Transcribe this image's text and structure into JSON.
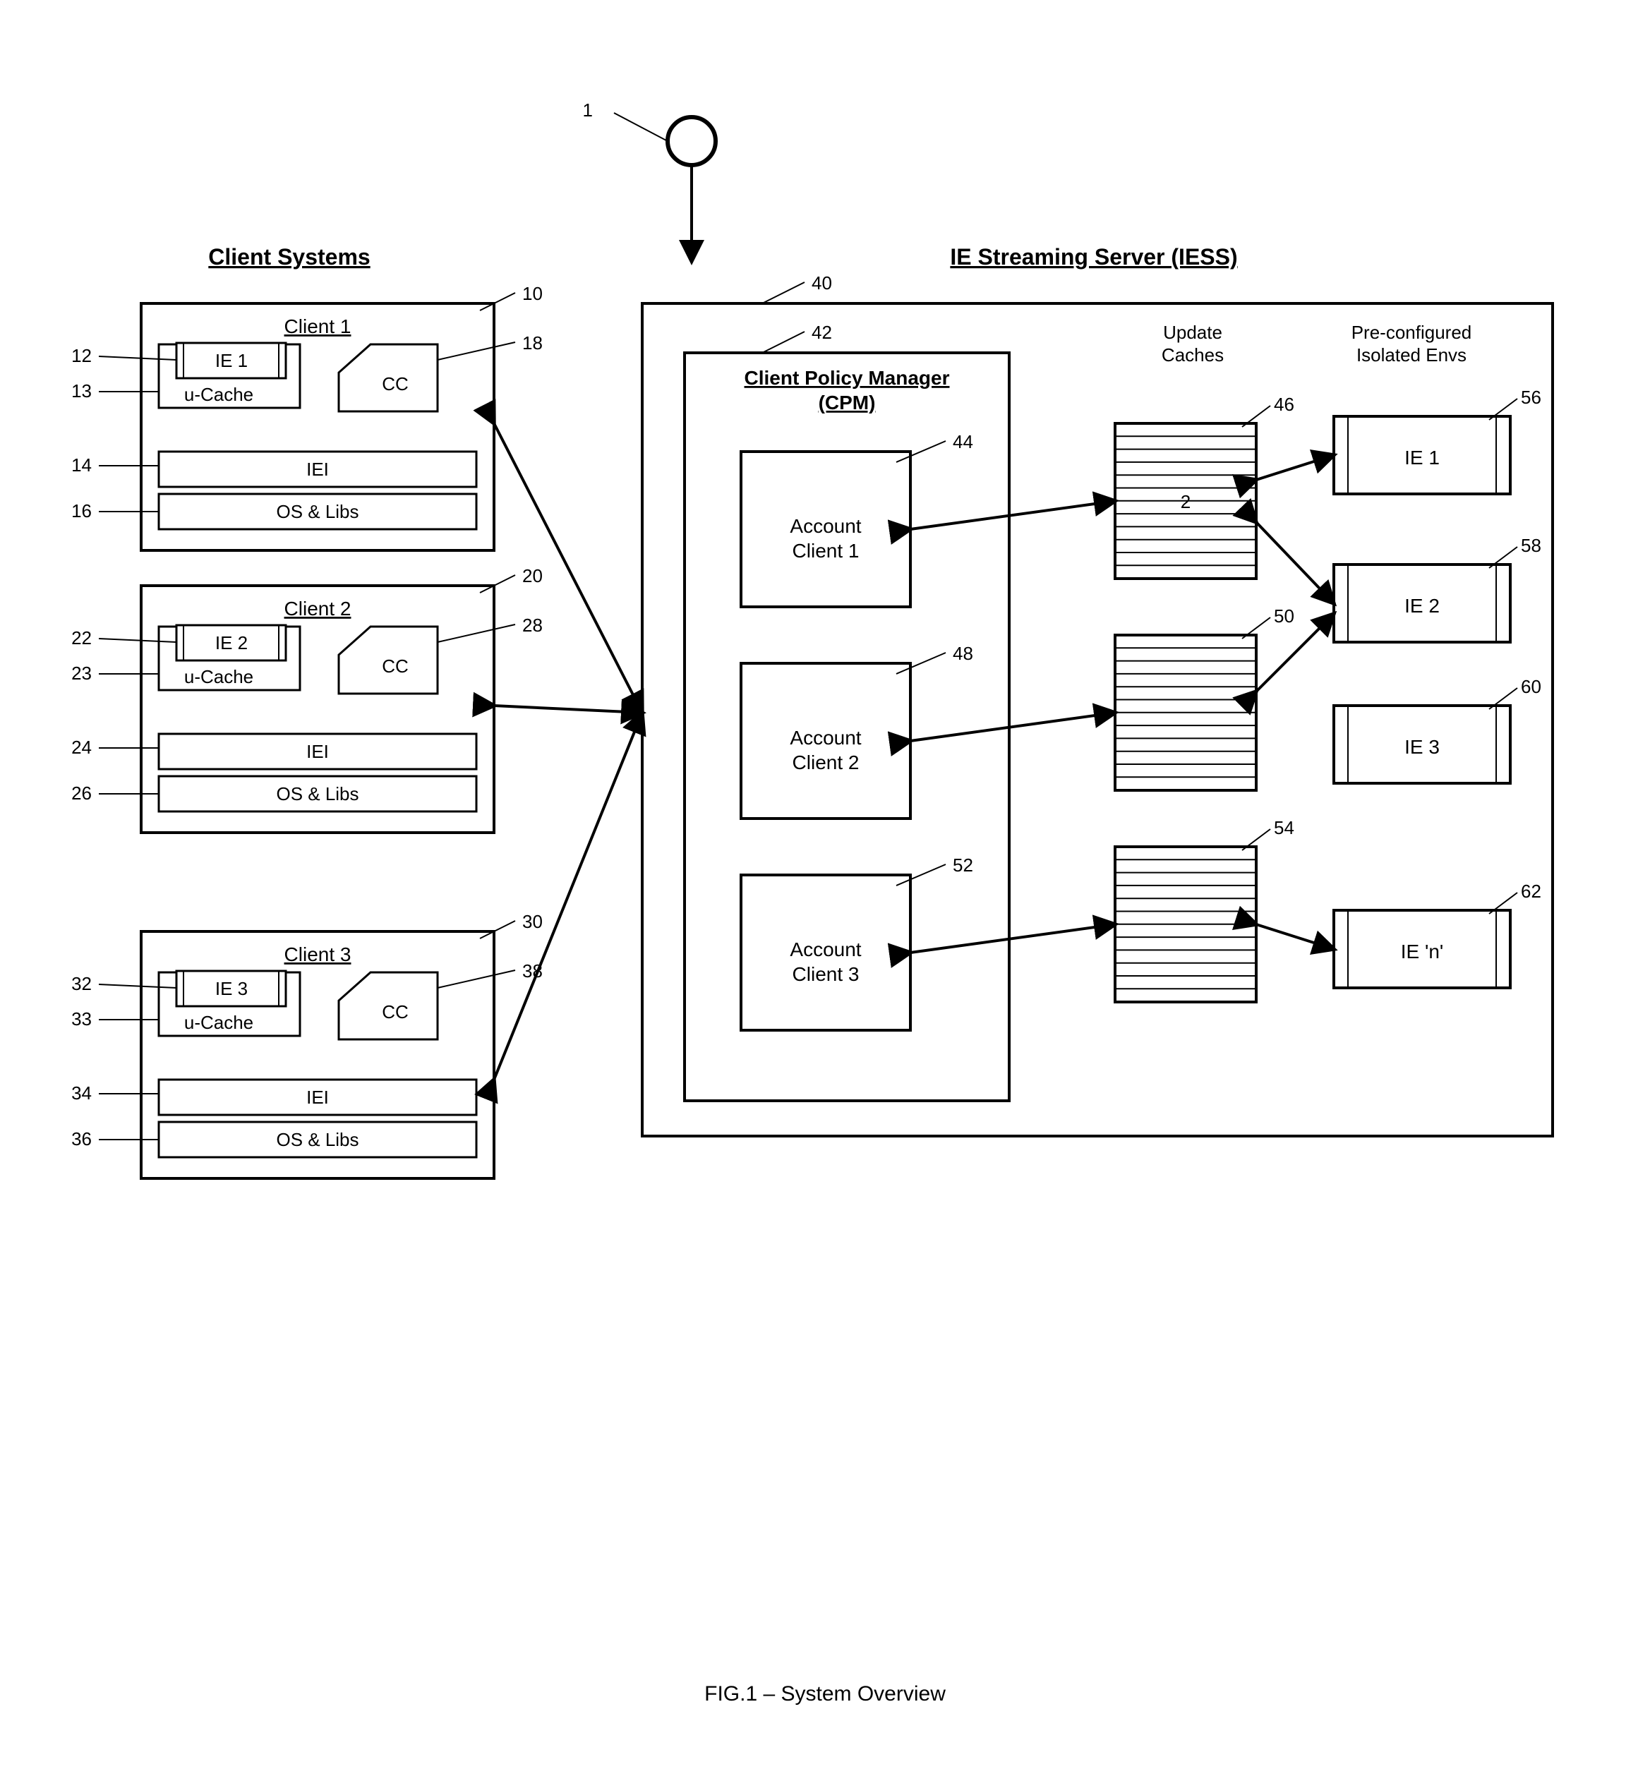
{
  "headers": {
    "clients": "Client Systems",
    "server": "IE Streaming Server (IESS)"
  },
  "topRef": "1",
  "clients": [
    {
      "title": "Client 1",
      "ie": "IE 1",
      "ucache": "u-Cache",
      "cc": "CC",
      "iei": "IEI",
      "os": "OS & Libs",
      "boxRef": "10",
      "ieRef": "12",
      "ucacheRef": "13",
      "ieiRef": "14",
      "osRef": "16",
      "ccRef": "18"
    },
    {
      "title": "Client 2",
      "ie": "IE 2",
      "ucache": "u-Cache",
      "cc": "CC",
      "iei": "IEI",
      "os": "OS & Libs",
      "boxRef": "20",
      "ieRef": "22",
      "ucacheRef": "23",
      "ieiRef": "24",
      "osRef": "26",
      "ccRef": "28"
    },
    {
      "title": "Client 3",
      "ie": "IE 3",
      "ucache": "u-Cache",
      "cc": "CC",
      "iei": "IEI",
      "os": "OS & Libs",
      "boxRef": "30",
      "ieRef": "32",
      "ucacheRef": "33",
      "ieiRef": "34",
      "osRef": "36",
      "ccRef": "38"
    }
  ],
  "server": {
    "boxRef": "40",
    "cpm": {
      "title1": "Client Policy Manager",
      "title2": "(CPM)",
      "boxRef": "42",
      "accounts": [
        {
          "l1": "Account",
          "l2": "Client 1",
          "ref": "44"
        },
        {
          "l1": "Account",
          "l2": "Client  2",
          "ref": "48"
        },
        {
          "l1": "Account",
          "l2": "Client 3",
          "ref": "52"
        }
      ]
    },
    "updateCaches": {
      "header1": "Update",
      "header2": "Caches",
      "innerLabel": "2",
      "refs": [
        "46",
        "50",
        "54"
      ]
    },
    "preEnvs": {
      "header1": "Pre-configured",
      "header2": "Isolated Envs",
      "items": [
        {
          "label": "IE 1",
          "ref": "56"
        },
        {
          "label": "IE 2",
          "ref": "58"
        },
        {
          "label": "IE 3",
          "ref": "60"
        },
        {
          "label": "IE 'n'",
          "ref": "62"
        }
      ]
    }
  },
  "figure": "FIG.1  – System Overview"
}
